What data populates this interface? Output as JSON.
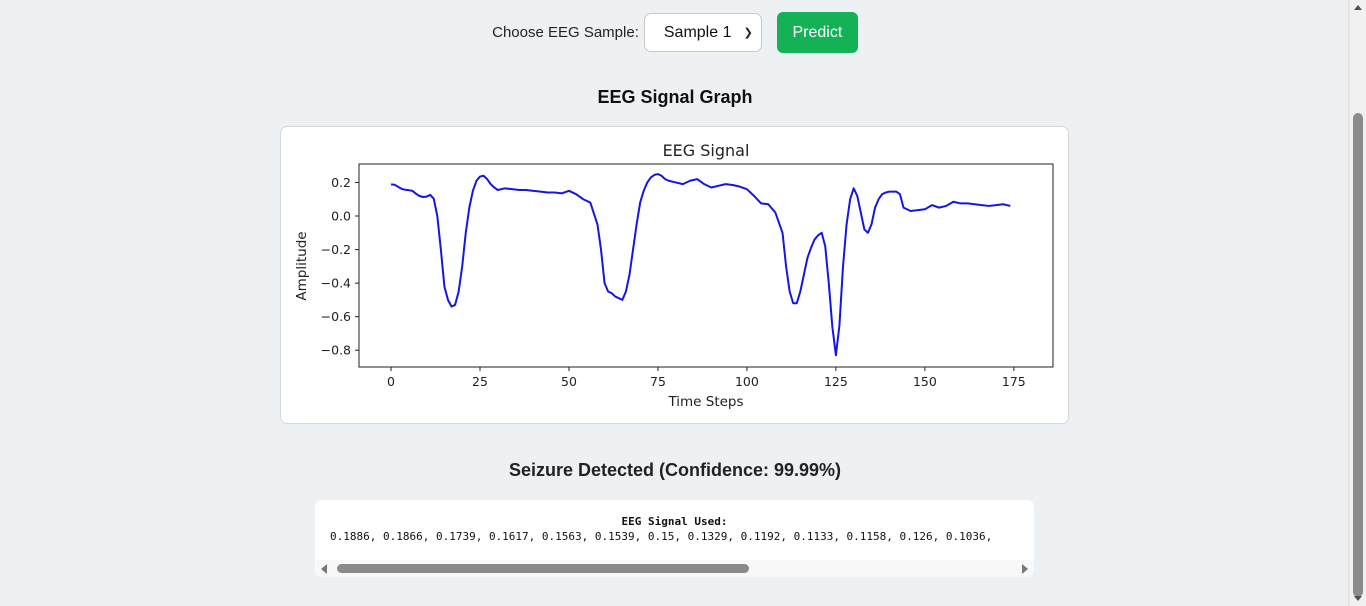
{
  "controls": {
    "sample_label": "Choose EEG Sample:",
    "sample_value": "Sample 1",
    "predict_label": "Predict"
  },
  "graph_section_title": "EEG Signal Graph",
  "result_text": "Seizure Detected (Confidence: 99.99%)",
  "signal": {
    "heading": "EEG Signal Used:",
    "values_text": "0.1886, 0.1866, 0.1739, 0.1617, 0.1563, 0.1539, 0.15, 0.1329, 0.1192, 0.1133, 0.1158, 0.126, 0.1036,"
  },
  "chart_data": {
    "type": "line",
    "title": "EEG Signal",
    "xlabel": "Time Steps",
    "ylabel": "Amplitude",
    "xlim": [
      -9,
      186
    ],
    "ylim": [
      -0.9,
      0.31
    ],
    "xticks": [
      0,
      25,
      50,
      75,
      100,
      125,
      150,
      175
    ],
    "xtick_labels": [
      "0",
      "25",
      "50",
      "75",
      "100",
      "125",
      "150",
      "175"
    ],
    "yticks": [
      0.2,
      0.0,
      -0.2,
      -0.4,
      -0.6,
      -0.8
    ],
    "ytick_labels": [
      "0.2",
      "0.0",
      "−0.2",
      "−0.4",
      "−0.6",
      "−0.8"
    ],
    "line_color": "#1515e6",
    "grid": false,
    "x": [
      0,
      1,
      2,
      3,
      4,
      5,
      6,
      7,
      8,
      9,
      10,
      11,
      12,
      13,
      14,
      15,
      16,
      17,
      18,
      19,
      20,
      21,
      22,
      23,
      24,
      25,
      26,
      27,
      28,
      29,
      30,
      32,
      34,
      36,
      38,
      40,
      42,
      44,
      46,
      48,
      50,
      52,
      54,
      56,
      58,
      59,
      60,
      61,
      62,
      63,
      64,
      65,
      66,
      67,
      68,
      69,
      70,
      71,
      72,
      73,
      74,
      75,
      76,
      77,
      78,
      80,
      82,
      84,
      86,
      88,
      90,
      92,
      94,
      96,
      98,
      100,
      102,
      104,
      106,
      108,
      110,
      111,
      112,
      113,
      114,
      115,
      116,
      117,
      118,
      119,
      120,
      121,
      122,
      123,
      124,
      125,
      126,
      127,
      128,
      129,
      130,
      131,
      132,
      133,
      134,
      135,
      136,
      137,
      138,
      139,
      140,
      141,
      142,
      143,
      144,
      146,
      148,
      150,
      152,
      154,
      156,
      158,
      160,
      162,
      164,
      166,
      168,
      170,
      172,
      174,
      176,
      177
    ],
    "y": [
      0.1886,
      0.1866,
      0.1739,
      0.1617,
      0.1563,
      0.1539,
      0.15,
      0.1329,
      0.1192,
      0.1133,
      0.1158,
      0.126,
      0.1036,
      -0.0,
      -0.2,
      -0.42,
      -0.5,
      -0.54,
      -0.53,
      -0.45,
      -0.3,
      -0.1,
      0.05,
      0.15,
      0.21,
      0.235,
      0.24,
      0.22,
      0.19,
      0.17,
      0.155,
      0.165,
      0.16,
      0.155,
      0.155,
      0.15,
      0.145,
      0.14,
      0.14,
      0.135,
      0.15,
      0.13,
      0.1,
      0.08,
      -0.05,
      -0.2,
      -0.4,
      -0.45,
      -0.46,
      -0.48,
      -0.49,
      -0.5,
      -0.45,
      -0.35,
      -0.2,
      -0.05,
      0.08,
      0.15,
      0.2,
      0.23,
      0.245,
      0.25,
      0.24,
      0.22,
      0.21,
      0.2,
      0.19,
      0.21,
      0.22,
      0.19,
      0.17,
      0.18,
      0.19,
      0.185,
      0.175,
      0.16,
      0.12,
      0.075,
      0.07,
      0.02,
      -0.1,
      -0.3,
      -0.45,
      -0.52,
      -0.52,
      -0.45,
      -0.35,
      -0.25,
      -0.19,
      -0.14,
      -0.115,
      -0.1,
      -0.18,
      -0.4,
      -0.66,
      -0.83,
      -0.65,
      -0.3,
      -0.05,
      0.1,
      0.165,
      0.12,
      0.02,
      -0.08,
      -0.1,
      -0.05,
      0.05,
      0.1,
      0.13,
      0.14,
      0.145,
      0.145,
      0.145,
      0.13,
      0.05,
      0.03,
      0.035,
      0.04,
      0.065,
      0.05,
      0.06,
      0.085,
      0.075,
      0.075,
      0.07,
      0.065,
      0.06,
      0.065,
      0.07,
      0.06
    ]
  }
}
